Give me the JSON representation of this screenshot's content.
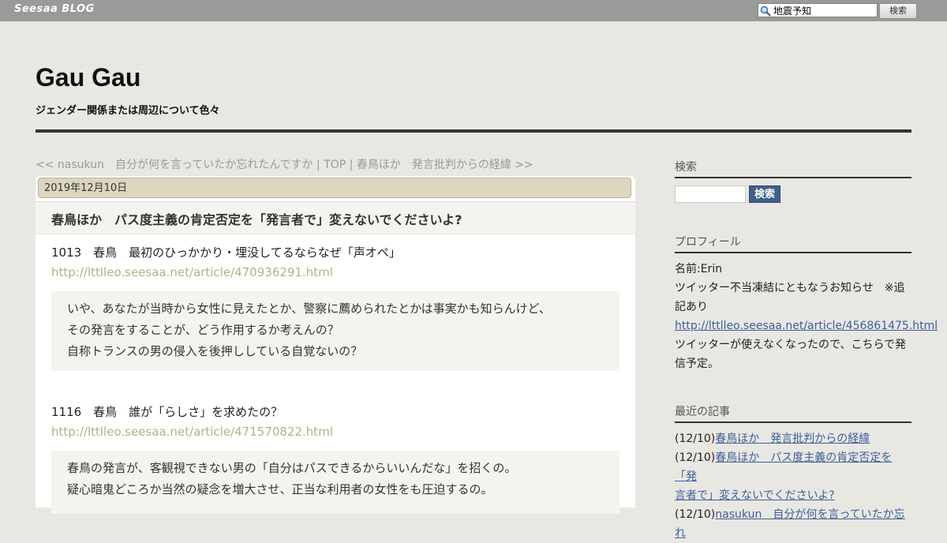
{
  "topbar": {
    "brand": "Seesaa BLOG",
    "search_value": "地震予知",
    "search_button": "検索"
  },
  "header": {
    "title": "Gau Gau",
    "description": "ジェンダー関係または周辺について色々"
  },
  "nav": {
    "prev": "<< nasukun　自分が何を言っていたか忘れたんですか",
    "sep1": " | ",
    "top": "TOP",
    "sep2": " | ",
    "next": "春鳥ほか　発言批判からの経緯 >>"
  },
  "article": {
    "date": "2019年12月10日",
    "title": "春鳥ほか　パス度主義の肯定否定を「発言者で」変えないでくださいよ?",
    "entries": [
      {
        "heading": "1013　春鳥　最初のひっかかり・埋没してるならなぜ「声オペ」",
        "link": "http://lttlleo.seesaa.net/article/470936291.html",
        "quote": [
          "いや、あなたが当時から女性に見えたとか、警察に薦められたとかは事実かも知らんけど、",
          "その発言をすることが、どう作用するか考えんの？",
          "自称トランスの男の侵入を後押ししている自覚ないの？"
        ]
      },
      {
        "heading": "1116　春鳥　誰が「らしさ」を求めたの？",
        "link": "http://lttlleo.seesaa.net/article/471570822.html",
        "quote": [
          "春鳥の発言が、客観視できない男の「自分はパスできるからいいんだな」を招くの。",
          "疑心暗鬼どころか当然の疑念を増大させ、正当な利用者の女性をも圧迫するの。"
        ]
      }
    ]
  },
  "sidebar": {
    "search_heading": "検索",
    "search_button": "検索",
    "profile_heading": "プロフィール",
    "profile_name": "名前:Erin",
    "profile_note_1": "ツイッター不当凍結にともなうお知らせ　※追",
    "profile_note_2": "記あり",
    "profile_link": "http://lttlleo.seesaa.net/article/456861475.html",
    "profile_note_3": "ツイッターが使えなくなったので、こちらで発",
    "profile_note_4": "信予定。",
    "recent_heading": "最近の記事",
    "recent": [
      {
        "date": "(12/10)",
        "title": "春鳥ほか　発言批判からの経緯"
      },
      {
        "date": "(12/10)",
        "title": "春鳥ほか　パス度主義の肯定否定を「発",
        "title2": "言者で」変えないでくださいよ?"
      },
      {
        "date": "(12/10)",
        "title": "nasukun　自分が何を言っていたか忘れ"
      }
    ]
  }
}
